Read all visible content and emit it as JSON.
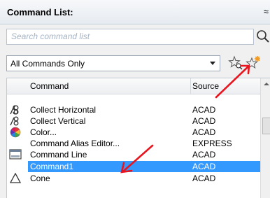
{
  "panel": {
    "title": "Command List:",
    "collapse_glyph": "≈"
  },
  "search": {
    "placeholder": "Search command list",
    "value": ""
  },
  "filter": {
    "selected": "All Commands Only"
  },
  "columns": {
    "command": "Command",
    "source": "Source"
  },
  "rows": [
    {
      "command": "Collect Horizontal",
      "source": "ACAD",
      "icon": "collect-horizontal-icon"
    },
    {
      "command": "Collect Vertical",
      "source": "ACAD",
      "icon": "collect-vertical-icon"
    },
    {
      "command": "Color...",
      "source": "ACAD",
      "icon": "color-wheel-icon"
    },
    {
      "command": "Command Alias Editor...",
      "source": "EXPRESS",
      "icon": ""
    },
    {
      "command": "Command Line",
      "source": "ACAD",
      "icon": "command-line-icon"
    },
    {
      "command": "Command1",
      "source": "ACAD",
      "icon": "",
      "selected": true
    },
    {
      "command": "Cone",
      "source": "ACAD",
      "icon": "cone-icon"
    }
  ],
  "colors": {
    "selection": "#3399ff",
    "annotation_arrow": "#e8141e"
  }
}
